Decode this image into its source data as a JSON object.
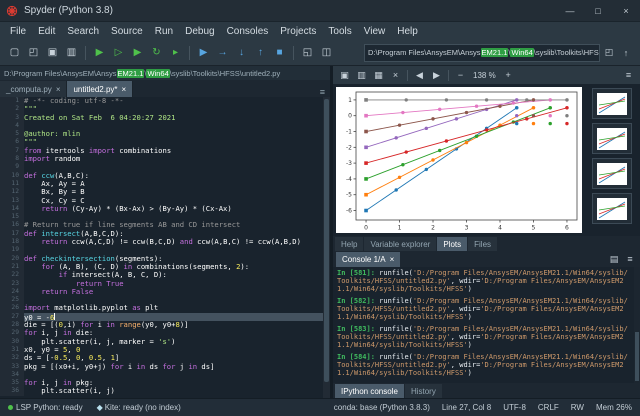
{
  "window": {
    "title": "Spyder (Python 3.8)",
    "controls": {
      "minimize": "—",
      "maximize": "□",
      "close": "×"
    }
  },
  "menu": {
    "items": [
      "File",
      "Edit",
      "Search",
      "Source",
      "Run",
      "Debug",
      "Consoles",
      "Projects",
      "Tools",
      "View",
      "Help"
    ]
  },
  "toolbar": {
    "icons": [
      {
        "name": "new-file-icon",
        "glyph": "▢",
        "color": "#c8d2da"
      },
      {
        "name": "open-file-icon",
        "glyph": "◰",
        "color": "#c8d2da"
      },
      {
        "name": "save-icon",
        "glyph": "▣",
        "color": "#c8d2da"
      },
      {
        "name": "save-all-icon",
        "glyph": "▥",
        "color": "#c8d2da"
      },
      {
        "sep": true
      },
      {
        "name": "run-file-icon",
        "glyph": "▶",
        "color": "#4fc14b"
      },
      {
        "name": "run-cell-icon",
        "glyph": "▷",
        "color": "#4fc14b"
      },
      {
        "name": "run-cell-advance-icon",
        "glyph": "▶",
        "color": "#4fc14b"
      },
      {
        "name": "rerun-cell-icon",
        "glyph": "↻",
        "color": "#4fc14b"
      },
      {
        "name": "run-selection-icon",
        "glyph": "▸",
        "color": "#4fc14b"
      },
      {
        "sep": true
      },
      {
        "name": "debug-file-icon",
        "glyph": "▶",
        "color": "#57a5e0"
      },
      {
        "name": "step-over-icon",
        "glyph": "→",
        "color": "#57a5e0"
      },
      {
        "name": "step-into-icon",
        "glyph": "↓",
        "color": "#57a5e0"
      },
      {
        "name": "step-return-icon",
        "glyph": "↑",
        "color": "#57a5e0"
      },
      {
        "name": "stop-debug-icon",
        "glyph": "■",
        "color": "#57a5e0"
      },
      {
        "sep": true
      },
      {
        "name": "maximize-pane-icon",
        "glyph": "◱",
        "color": "#c8d2da"
      },
      {
        "name": "layout-icon",
        "glyph": "◫",
        "color": "#c8d2da"
      }
    ],
    "cwd_segments": [
      {
        "t": "D:\\Program Files\\AnsysEM\\Ansys"
      },
      {
        "t": "EM21.1",
        "hl": true
      },
      {
        "t": "\\"
      },
      {
        "t": "Win64",
        "hl": true
      },
      {
        "t": "\\syslib\\Toolkits\\HFSS"
      }
    ],
    "dropdown_glyph": "▾",
    "browse_glyph": "◰",
    "parent_glyph": "↑"
  },
  "editor": {
    "breadcrumb_segments": [
      {
        "t": "D:\\Program Files\\AnsysEM\\Ansys"
      },
      {
        "t": "EM21.1",
        "hl": true
      },
      {
        "t": "\\"
      },
      {
        "t": "Win64",
        "hl": true
      },
      {
        "t": "\\syslib\\Toolkits\\HFSS\\untitled2.py"
      }
    ],
    "tabs": [
      {
        "label": "_computa.py",
        "active": false,
        "close": "×"
      },
      {
        "label": "untitled2.py*",
        "active": true,
        "close": "×"
      }
    ],
    "tab_menu_glyph": "≡",
    "current_line": 27,
    "lines": [
      [
        {
          "t": "# -*- coding: utf-8 -*-",
          "c": "c"
        }
      ],
      [
        {
          "t": "\"\"\"",
          "c": "s"
        }
      ],
      [
        {
          "t": "Created on Sat Feb  6 04:20:27 2021",
          "c": "s"
        }
      ],
      [],
      [
        {
          "t": "@author: mlin",
          "c": "s"
        }
      ],
      [
        {
          "t": "\"\"\"",
          "c": "s"
        }
      ],
      [
        {
          "t": "from",
          "c": "k"
        },
        {
          "t": " itertools ",
          "c": "t"
        },
        {
          "t": "import",
          "c": "k"
        },
        {
          "t": " combinations",
          "c": "t"
        }
      ],
      [
        {
          "t": "import",
          "c": "k"
        },
        {
          "t": " random",
          "c": "t"
        }
      ],
      [],
      [
        {
          "t": "def",
          "c": "k"
        },
        {
          "t": " ",
          "c": "t"
        },
        {
          "t": "ccw",
          "c": "d"
        },
        {
          "t": "(A,B,C):",
          "c": "t"
        }
      ],
      [
        {
          "t": "    Ax, Ay = A",
          "c": "t"
        }
      ],
      [
        {
          "t": "    Bx, By = B",
          "c": "t"
        }
      ],
      [
        {
          "t": "    Cx, Cy = C",
          "c": "t"
        }
      ],
      [
        {
          "t": "    ",
          "c": "t"
        },
        {
          "t": "return",
          "c": "k"
        },
        {
          "t": " (Cy-Ay) * (Bx-Ax) > (By-Ay) * (Cx-Ax)",
          "c": "t"
        }
      ],
      [],
      [
        {
          "t": "# Return true if line segments AB and CD intersect",
          "c": "c"
        }
      ],
      [
        {
          "t": "def",
          "c": "k"
        },
        {
          "t": " ",
          "c": "t"
        },
        {
          "t": "intersect",
          "c": "d"
        },
        {
          "t": "(A,B,C,D):",
          "c": "t"
        }
      ],
      [
        {
          "t": "    ",
          "c": "t"
        },
        {
          "t": "return",
          "c": "k"
        },
        {
          "t": " ccw(A,C,D) != ccw(B,C,D) ",
          "c": "t"
        },
        {
          "t": "and",
          "c": "k"
        },
        {
          "t": " ccw(A,B,C) != ccw(A,B,D)",
          "c": "t"
        }
      ],
      [],
      [
        {
          "t": "def",
          "c": "k"
        },
        {
          "t": " ",
          "c": "t"
        },
        {
          "t": "checkintersection",
          "c": "d"
        },
        {
          "t": "(segments):",
          "c": "t"
        }
      ],
      [
        {
          "t": "    ",
          "c": "t"
        },
        {
          "t": "for",
          "c": "k"
        },
        {
          "t": " (A, B), (C, D) ",
          "c": "t"
        },
        {
          "t": "in",
          "c": "k"
        },
        {
          "t": " combinations(segments, ",
          "c": "t"
        },
        {
          "t": "2",
          "c": "n"
        },
        {
          "t": "):",
          "c": "t"
        }
      ],
      [
        {
          "t": "        ",
          "c": "t"
        },
        {
          "t": "if",
          "c": "k"
        },
        {
          "t": " intersect(A, B, C, D):",
          "c": "t"
        }
      ],
      [
        {
          "t": "            ",
          "c": "t"
        },
        {
          "t": "return",
          "c": "k"
        },
        {
          "t": " ",
          "c": "t"
        },
        {
          "t": "True",
          "c": "k"
        }
      ],
      [
        {
          "t": "    ",
          "c": "t"
        },
        {
          "t": "return",
          "c": "k"
        },
        {
          "t": " ",
          "c": "t"
        },
        {
          "t": "False",
          "c": "k"
        }
      ],
      [],
      [
        {
          "t": "import",
          "c": "k"
        },
        {
          "t": " matplotlib.pyplot ",
          "c": "t"
        },
        {
          "t": "as",
          "c": "k"
        },
        {
          "t": " plt",
          "c": "t"
        }
      ],
      [
        {
          "t": "y0 = -",
          "c": "t"
        },
        {
          "t": "6",
          "c": "n"
        }
      ],
      [
        {
          "t": "die = [(",
          "c": "t"
        },
        {
          "t": "0",
          "c": "n"
        },
        {
          "t": ",i) ",
          "c": "t"
        },
        {
          "t": "for",
          "c": "k"
        },
        {
          "t": " i ",
          "c": "t"
        },
        {
          "t": "in",
          "c": "k"
        },
        {
          "t": " ",
          "c": "t"
        },
        {
          "t": "range",
          "c": "b"
        },
        {
          "t": "(y0, y0+",
          "c": "t"
        },
        {
          "t": "8",
          "c": "n"
        },
        {
          "t": ")]",
          "c": "t"
        }
      ],
      [
        {
          "t": "for",
          "c": "k"
        },
        {
          "t": " i, j ",
          "c": "t"
        },
        {
          "t": "in",
          "c": "k"
        },
        {
          "t": " die:",
          "c": "t"
        }
      ],
      [
        {
          "t": "    plt.scatter(i, j, marker = ",
          "c": "t"
        },
        {
          "t": "'s'",
          "c": "s"
        },
        {
          "t": ")",
          "c": "t"
        }
      ],
      [
        {
          "t": "x0, y0 = ",
          "c": "t"
        },
        {
          "t": "5",
          "c": "n"
        },
        {
          "t": ", ",
          "c": "t"
        },
        {
          "t": "0",
          "c": "n"
        }
      ],
      [
        {
          "t": "ds = [-",
          "c": "t"
        },
        {
          "t": "0.5",
          "c": "n"
        },
        {
          "t": ", ",
          "c": "t"
        },
        {
          "t": "0",
          "c": "n"
        },
        {
          "t": ", ",
          "c": "t"
        },
        {
          "t": "0.5",
          "c": "n"
        },
        {
          "t": ", ",
          "c": "t"
        },
        {
          "t": "1",
          "c": "n"
        },
        {
          "t": "]",
          "c": "t"
        }
      ],
      [
        {
          "t": "pkg = [(x0+i, y0+j) ",
          "c": "t"
        },
        {
          "t": "for",
          "c": "k"
        },
        {
          "t": " i ",
          "c": "t"
        },
        {
          "t": "in",
          "c": "k"
        },
        {
          "t": " ds ",
          "c": "t"
        },
        {
          "t": "for",
          "c": "k"
        },
        {
          "t": " j ",
          "c": "t"
        },
        {
          "t": "in",
          "c": "k"
        },
        {
          "t": " ds]",
          "c": "t"
        }
      ],
      [],
      [
        {
          "t": "for",
          "c": "k"
        },
        {
          "t": " i, j ",
          "c": "t"
        },
        {
          "t": "in",
          "c": "k"
        },
        {
          "t": " pkg:",
          "c": "t"
        }
      ],
      [
        {
          "t": "    plt.scatter(i, j)",
          "c": "t"
        }
      ]
    ]
  },
  "plots": {
    "toolbar": {
      "icons": [
        {
          "name": "save-plot-icon",
          "glyph": "▣"
        },
        {
          "name": "save-all-plots-icon",
          "glyph": "▥"
        },
        {
          "name": "copy-plot-icon",
          "glyph": "▦"
        },
        {
          "name": "remove-plot-icon",
          "glyph": "×"
        },
        {
          "sep": true
        },
        {
          "name": "previous-plot-icon",
          "glyph": "◀"
        },
        {
          "name": "next-plot-icon",
          "glyph": "▶"
        },
        {
          "sep": true
        },
        {
          "name": "zoom-out-icon",
          "glyph": "−"
        }
      ],
      "zoom_label": "138 %",
      "zoom_in_glyph": "+",
      "menu_glyph": "≡"
    },
    "thumbnail_count": 4
  },
  "pane_tabs": {
    "items": [
      {
        "label": "Help",
        "active": false
      },
      {
        "label": "Variable explorer",
        "active": false
      },
      {
        "label": "Plots",
        "active": true
      },
      {
        "label": "Files",
        "active": false
      }
    ]
  },
  "console": {
    "tab_label": "Console 1/A",
    "close_glyph": "×",
    "icons": [
      {
        "name": "console-options-icon",
        "glyph": "▤"
      },
      {
        "name": "console-menu-icon",
        "glyph": "≡"
      }
    ],
    "prompts": [
      "581",
      "582",
      "583",
      "584"
    ],
    "runfile_tokens": [
      {
        "t": "runfile(",
        "c": "cw"
      },
      {
        "t": "'D:/Program Files/AnsysEM/AnsysEM21.1/Win64/syslib/Toolkits/HFSS/untitled2.py'",
        "c": "cs"
      },
      {
        "t": ", wdir=",
        "c": "cw"
      },
      {
        "t": "'D:/Program Files/AnsysEM/AnsysEM21.1/Win64/syslib/Toolkits/HFSS'",
        "c": "cs"
      },
      {
        "t": ")",
        "c": "cw"
      }
    ]
  },
  "bottom_tabs": {
    "items": [
      {
        "label": "IPython console",
        "active": true
      },
      {
        "label": "History",
        "active": false
      }
    ]
  },
  "statusbar": {
    "lsp": {
      "label": "LSP Python: ready"
    },
    "kite": {
      "label": "Kite: ready (no index)",
      "icon_glyph": "◆"
    },
    "right": [
      "conda: base (Python 3.8.3)",
      "Line 27, Col 8",
      "UTF-8",
      "CRLF",
      "RW",
      "Mem 26%"
    ]
  },
  "colors": {
    "accent_green": "#2f9e44",
    "prompt_green": "#3fba5e",
    "console_string": "#cf9a6b",
    "editor_bg": "#19232D",
    "chrome_bg": "#2c3943"
  },
  "chart_data": {
    "type": "line",
    "title": "",
    "xlabel": "",
    "ylabel": "",
    "xlim": [
      -0.3,
      6.3
    ],
    "ylim": [
      -6.6,
      1.5
    ],
    "xticks": [
      0,
      1,
      2,
      3,
      4,
      5,
      6
    ],
    "yticks": [
      1,
      0,
      -1,
      -2,
      -3,
      -4,
      -5,
      -6
    ],
    "grid": false,
    "legend": "none",
    "colors": [
      "#1f77b4",
      "#ff7f0e",
      "#2ca02c",
      "#d62728",
      "#9467bd",
      "#8c564b",
      "#e377c2",
      "#7f7f7f"
    ],
    "lines": [
      {
        "start": [
          0,
          -6
        ],
        "end": [
          4.5,
          0.5
        ]
      },
      {
        "start": [
          0,
          -5
        ],
        "end": [
          5.0,
          0.5
        ]
      },
      {
        "start": [
          0,
          -4
        ],
        "end": [
          5.5,
          0.5
        ]
      },
      {
        "start": [
          0,
          -3
        ],
        "end": [
          6.0,
          0.5
        ]
      },
      {
        "start": [
          0,
          -2
        ],
        "end": [
          4.5,
          1.0
        ]
      },
      {
        "start": [
          0,
          -1
        ],
        "end": [
          5.0,
          1.0
        ]
      },
      {
        "start": [
          0,
          0
        ],
        "end": [
          5.5,
          1.0
        ]
      },
      {
        "start": [
          0,
          1
        ],
        "end": [
          6.0,
          1.0
        ]
      }
    ],
    "markers_per_line": 6,
    "die_points": [
      [
        0,
        -6
      ],
      [
        0,
        -5
      ],
      [
        0,
        -4
      ],
      [
        0,
        -3
      ],
      [
        0,
        -2
      ],
      [
        0,
        -1
      ],
      [
        0,
        0
      ],
      [
        0,
        1
      ]
    ],
    "pkg_points_x": [
      4.5,
      5,
      5.5,
      6
    ],
    "pkg_points_y": [
      -0.5,
      0,
      0.5,
      1
    ]
  }
}
